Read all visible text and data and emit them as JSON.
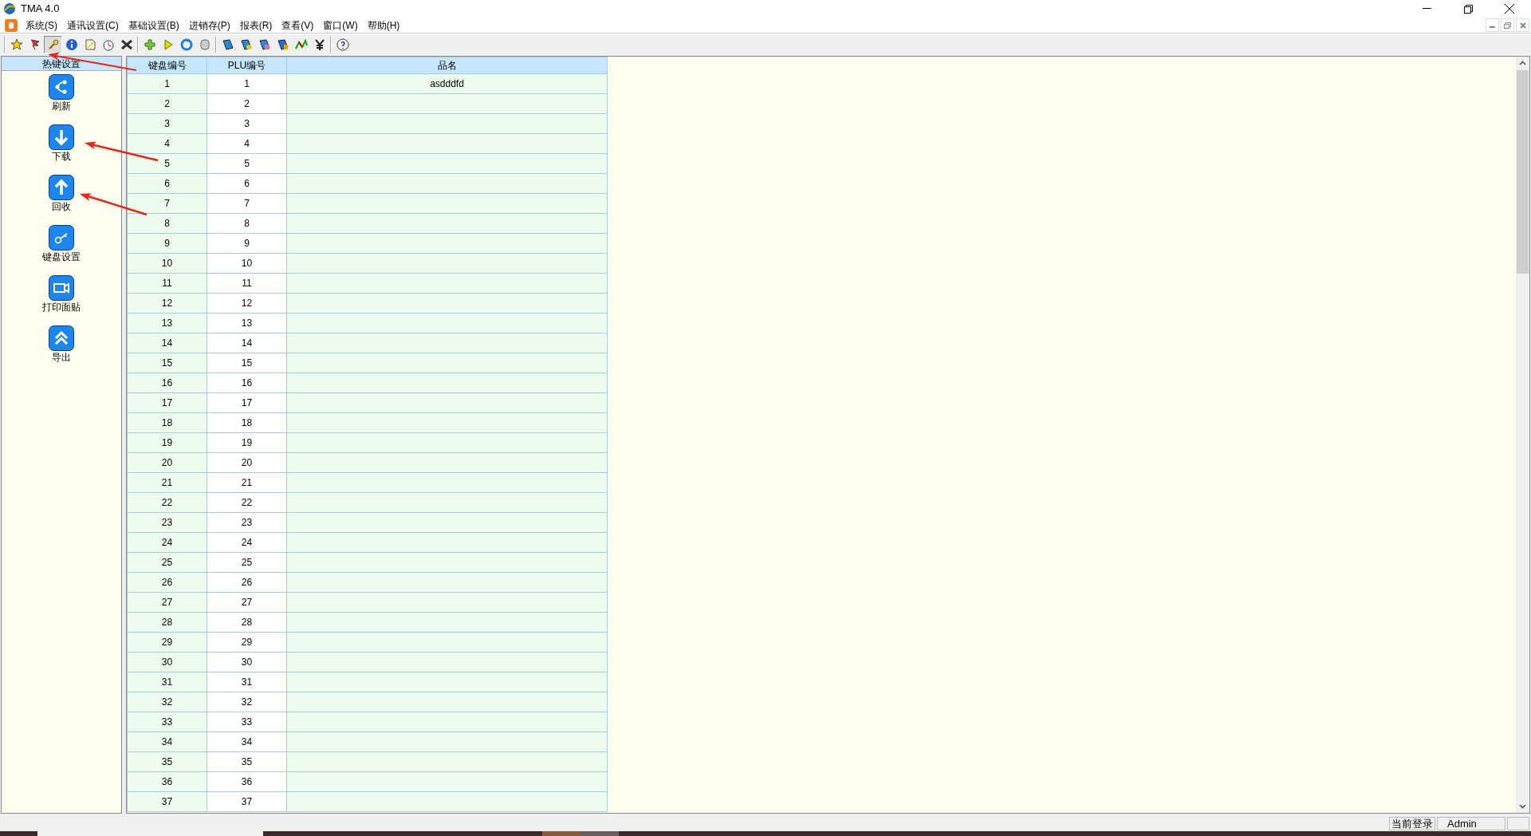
{
  "window": {
    "title": "TMA 4.0"
  },
  "menu": [
    "系统(S)",
    "通讯设置(C)",
    "基础设置(B)",
    "进销存(P)",
    "报表(R)",
    "查看(V)",
    "窗口(W)",
    "帮助(H)"
  ],
  "toolbar": [
    [
      {
        "pressed": false
      },
      {
        "pressed": false
      },
      {
        "pressed": true
      },
      {
        "pressed": false
      },
      {
        "pressed": false
      },
      {
        "pressed": false
      },
      {
        "pressed": false
      }
    ],
    [
      {
        "pressed": false
      },
      {
        "pressed": false
      },
      {
        "pressed": false
      },
      {
        "pressed": false
      }
    ],
    [
      {
        "pressed": false
      },
      {
        "pressed": false
      },
      {
        "pressed": false
      },
      {
        "pressed": false
      },
      {
        "pressed": false
      },
      {
        "pressed": false
      }
    ],
    [
      {
        "pressed": false
      }
    ]
  ],
  "hotkey_panel": {
    "title": "热键设置",
    "items": [
      "刷新",
      "下载",
      "回收",
      "键盘设置",
      "打印面贴",
      "导出"
    ]
  },
  "table": {
    "columns": [
      "键盘编号",
      "PLU编号",
      "品名"
    ],
    "rows": [
      {
        "key_no": "1",
        "plu_no": "1",
        "name": "asdddfd"
      },
      {
        "key_no": "2",
        "plu_no": "2"
      },
      {
        "key_no": "3",
        "plu_no": "3"
      },
      {
        "key_no": "4",
        "plu_no": "4"
      },
      {
        "key_no": "5",
        "plu_no": "5"
      },
      {
        "key_no": "6",
        "plu_no": "6"
      },
      {
        "key_no": "7",
        "plu_no": "7"
      },
      {
        "key_no": "8",
        "plu_no": "8"
      },
      {
        "key_no": "9",
        "plu_no": "9"
      },
      {
        "key_no": "10",
        "plu_no": "10"
      },
      {
        "key_no": "11",
        "plu_no": "11"
      },
      {
        "key_no": "12",
        "plu_no": "12"
      },
      {
        "key_no": "13",
        "plu_no": "13"
      },
      {
        "key_no": "14",
        "plu_no": "14"
      },
      {
        "key_no": "15",
        "plu_no": "15"
      },
      {
        "key_no": "16",
        "plu_no": "16"
      },
      {
        "key_no": "17",
        "plu_no": "17"
      },
      {
        "key_no": "18",
        "plu_no": "18"
      },
      {
        "key_no": "19",
        "plu_no": "19"
      },
      {
        "key_no": "20",
        "plu_no": "20"
      },
      {
        "key_no": "21",
        "plu_no": "21"
      },
      {
        "key_no": "22",
        "plu_no": "22"
      },
      {
        "key_no": "23",
        "plu_no": "23"
      },
      {
        "key_no": "24",
        "plu_no": "24"
      },
      {
        "key_no": "25",
        "plu_no": "25"
      },
      {
        "key_no": "26",
        "plu_no": "26"
      },
      {
        "key_no": "27",
        "plu_no": "27"
      },
      {
        "key_no": "28",
        "plu_no": "28"
      },
      {
        "key_no": "29",
        "plu_no": "29"
      },
      {
        "key_no": "30",
        "plu_no": "30"
      },
      {
        "key_no": "31",
        "plu_no": "31"
      },
      {
        "key_no": "32",
        "plu_no": "32"
      },
      {
        "key_no": "33",
        "plu_no": "33"
      },
      {
        "key_no": "34",
        "plu_no": "34"
      },
      {
        "key_no": "35",
        "plu_no": "35"
      },
      {
        "key_no": "36",
        "plu_no": "36"
      },
      {
        "key_no": "37",
        "plu_no": "37"
      }
    ]
  },
  "status_bar": {
    "label": "当前登录",
    "user": "Admin"
  }
}
